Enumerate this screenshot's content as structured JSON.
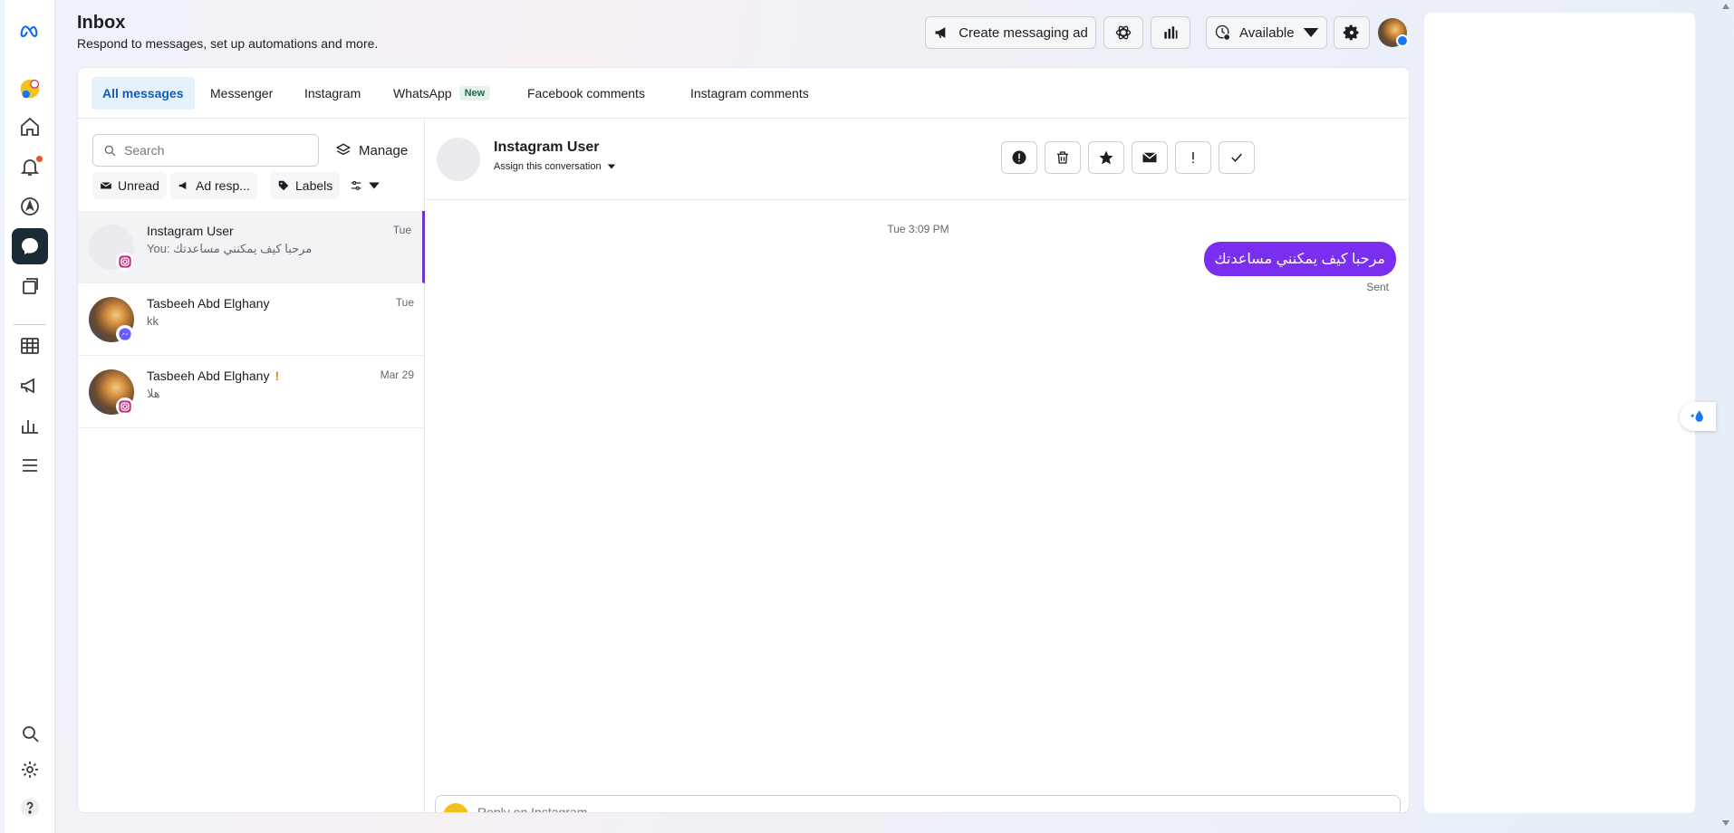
{
  "header": {
    "title": "Inbox",
    "subtitle": "Respond to messages, set up automations and more.",
    "create_ad_label": "Create messaging ad",
    "status_label": "Available"
  },
  "tabs": [
    {
      "label": "All messages"
    },
    {
      "label": "Messenger"
    },
    {
      "label": "Instagram"
    },
    {
      "label": "WhatsApp",
      "badge": "New"
    },
    {
      "label": "Facebook comments"
    },
    {
      "label": "Instagram comments"
    }
  ],
  "list": {
    "search_placeholder": "Search",
    "manage_label": "Manage",
    "filters": {
      "unread": "Unread",
      "ad": "Ad resp...",
      "labels": "Labels"
    },
    "conversations": [
      {
        "name": "Instagram User",
        "preview": "You: مرحبا كيف يمكنني مساعدتك",
        "time": "Tue",
        "platform": "instagram-icon"
      },
      {
        "name": "Tasbeeh Abd Elghany",
        "preview": "kk",
        "time": "Tue",
        "platform": "messenger-icon"
      },
      {
        "name": "Tasbeeh Abd Elghany",
        "preview": "هلا",
        "time": "Mar 29",
        "platform": "instagram-icon",
        "flag": "!"
      }
    ]
  },
  "thread": {
    "name": "Instagram User",
    "assign_label": "Assign this conversation",
    "timestamp": "Tue 3:09 PM",
    "message": "مرحبا كيف يمكنني مساعدتك",
    "status": "Sent",
    "reply_placeholder": "Reply on Instagram..."
  },
  "colors": {
    "accent": "#0a5ec0",
    "bubble": "#7a2ff0",
    "rail_active": "#1c2b33"
  }
}
